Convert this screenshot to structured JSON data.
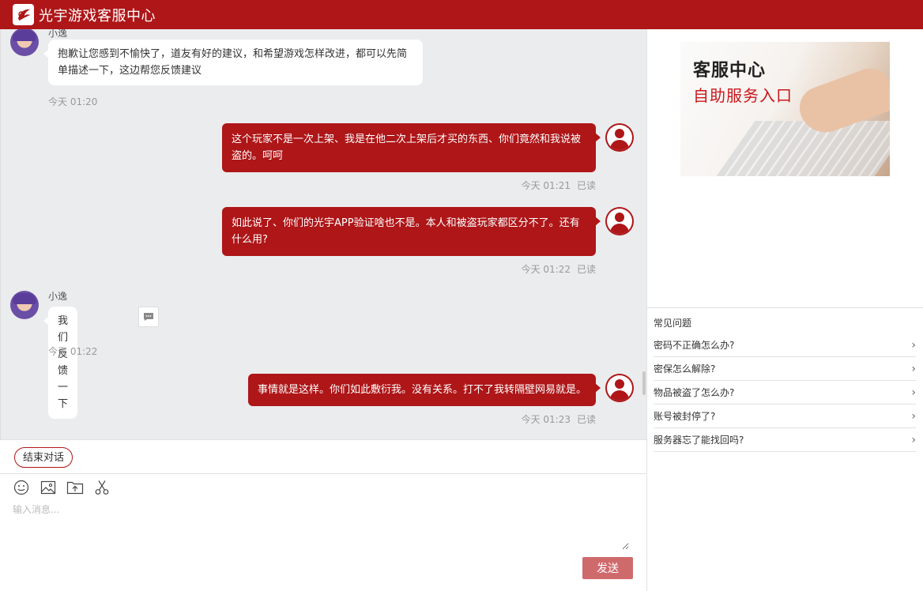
{
  "header": {
    "title": "光宇游戏客服中心"
  },
  "messages": [
    {
      "from": "agent",
      "name": "小逸",
      "text": "抱歉让您感到不愉快了，道友有好的建议，和希望游戏怎样改进，都可以先简单描述一下，这边帮您反馈建议",
      "time": "今天 01:20"
    },
    {
      "from": "user",
      "text": "这个玩家不是一次上架、我是在他二次上架后才买的东西、你们竟然和我说被盗的。呵呵",
      "time": "今天 01:21",
      "status": "已读"
    },
    {
      "from": "user",
      "text": "如此说了、你们的光宇APP验证啥也不是。本人和被盗玩家都区分不了。还有什么用?",
      "time": "今天 01:22",
      "status": "已读"
    },
    {
      "from": "agent",
      "name": "小逸",
      "text": "我们反馈一下",
      "time": "今天 01:22"
    },
    {
      "from": "user",
      "text": "事情就是这样。你们如此敷衍我。没有关系。打不了我转隔壁网易就是。",
      "time": "今天 01:23",
      "status": "已读"
    }
  ],
  "actions": {
    "end_chat": "结束对话",
    "send": "发送"
  },
  "composer": {
    "placeholder": "输入消息..."
  },
  "sidebar": {
    "banner_title": "客服中心",
    "banner_subtitle": "自助服务入口",
    "faq_title": "常见问题",
    "faq": [
      "密码不正确怎么办?",
      "密保怎么解除?",
      "物品被盗了怎么办?",
      "账号被封停了?",
      "服务器忘了能找回吗?"
    ]
  },
  "colors": {
    "brand": "#ae1618",
    "send_disabled": "#cf6a6c"
  }
}
